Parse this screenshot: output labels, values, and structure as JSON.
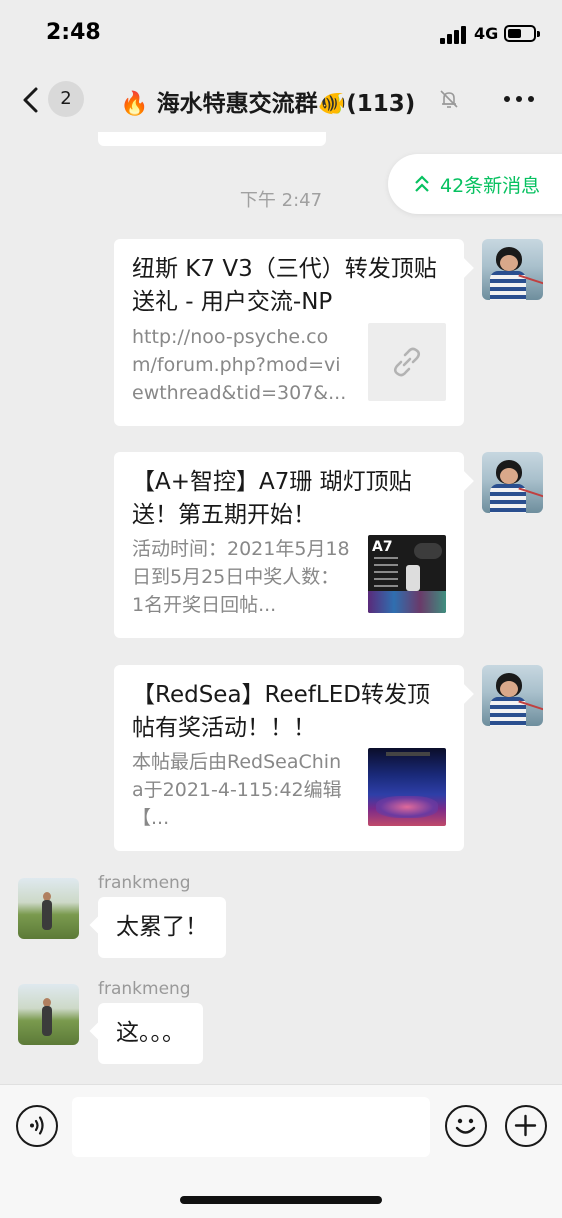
{
  "status_bar": {
    "time": "2:48",
    "network": "4G",
    "battery_level": 0.55
  },
  "nav": {
    "unread_count": "2",
    "title": "🔥 海水特惠交流群🐠(113)",
    "icons": [
      "back-icon",
      "mute-icon",
      "more-icon"
    ]
  },
  "chat": {
    "time_label": "下午 2:47",
    "new_messages": "42条新消息",
    "link_cards": [
      {
        "title": "纽斯 K7 V3（三代）转发顶贴送礼 - 用户交流-NP",
        "desc": "http://noo-psyche.com/forum.php?mod=viewthread&tid=307&...",
        "thumb": "link-icon"
      },
      {
        "title": "【A+智控】A7珊 瑚灯顶贴送！第五期开始！",
        "desc": "活动时间：2021年5月18日到5月25日中奖人数：1名开奖日回帖...",
        "thumb": "A7"
      },
      {
        "title": "【RedSea】ReefLED转发顶帖有奖活动！！！",
        "desc": "本帖最后由RedSeaChina于2021-4-115:42编辑【...",
        "thumb": "reef-tank-image"
      }
    ],
    "text_messages": [
      {
        "sender": "frankmeng",
        "text": "太累了！"
      },
      {
        "sender": "frankmeng",
        "text": "这。。。"
      }
    ]
  },
  "input_bar": {
    "message_value": "",
    "icons": [
      "voice-icon",
      "emoji-icon",
      "plus-icon"
    ]
  }
}
